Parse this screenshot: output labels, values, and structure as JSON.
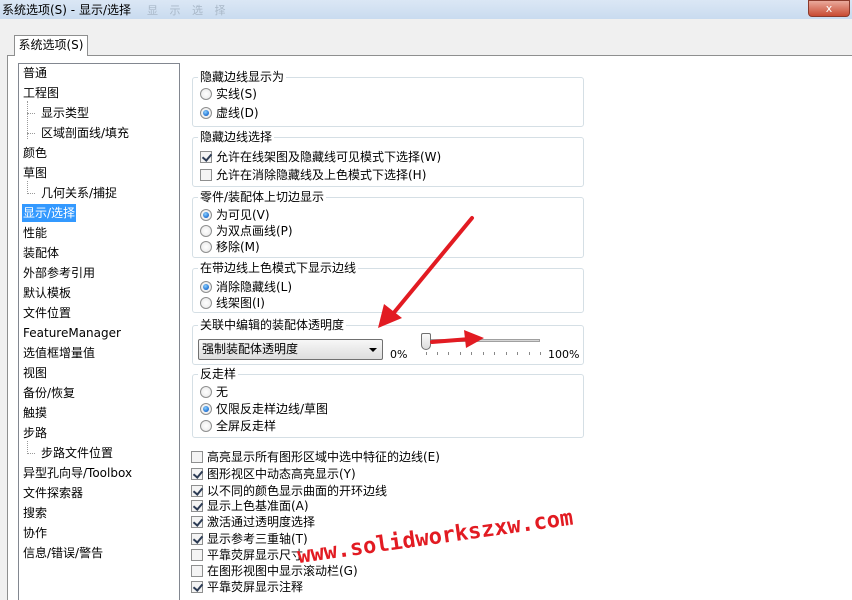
{
  "window": {
    "title": "系统选项(S) - 显示/选择",
    "faint_title": "显 示 选 择",
    "close_label": "x"
  },
  "tab": {
    "label": "系统选项(S)"
  },
  "tree": {
    "items": [
      "普通",
      "工程图",
      "显示类型",
      "区域剖面线/填充",
      "颜色",
      "草图",
      "几何关系/捕捉",
      "显示/选择",
      "性能",
      "装配体",
      "外部参考引用",
      "默认模板",
      "文件位置",
      "FeatureManager",
      "选值框增量值",
      "视图",
      "备份/恢复",
      "触摸",
      "步路",
      "步路文件位置",
      "异型孔向导/Toolbox",
      "文件探索器",
      "搜索",
      "协作",
      "信息/错误/警告"
    ]
  },
  "groups": {
    "hidden_edges_display": {
      "title": "隐藏边线显示为",
      "options": [
        {
          "label": "实线(S)",
          "selected": false
        },
        {
          "label": "虚线(D)",
          "selected": true
        }
      ]
    },
    "hidden_edges_select": {
      "title": "隐藏边线选择",
      "options": [
        {
          "label": "允许在线架图及隐藏线可见模式下选择(W)",
          "checked": true
        },
        {
          "label": "允许在消除隐藏线及上色模式下选择(H)",
          "checked": false
        }
      ]
    },
    "tangent_edges": {
      "title": "零件/装配体上切边显示",
      "options": [
        {
          "label": "为可见(V)",
          "selected": true
        },
        {
          "label": "为双点画线(P)",
          "selected": false
        },
        {
          "label": "移除(M)",
          "selected": false
        }
      ]
    },
    "shaded_edges": {
      "title": "在带边线上色模式下显示边线",
      "options": [
        {
          "label": "消除隐藏线(L)",
          "selected": true
        },
        {
          "label": "线架图(I)",
          "selected": false
        }
      ]
    },
    "transparency": {
      "title": "关联中编辑的装配体透明度",
      "dropdown_value": "强制装配体透明度",
      "min_label": "0%",
      "max_label": "100%",
      "slider_value": 0
    },
    "antialias": {
      "title": "反走样",
      "options": [
        {
          "label": "无",
          "selected": false
        },
        {
          "label": "仅限反走样边线/草图",
          "selected": true
        },
        {
          "label": "全屏反走样",
          "selected": false
        }
      ]
    }
  },
  "checkboxes": [
    {
      "label": "高亮显示所有图形区域中选中特征的边线(E)",
      "checked": false
    },
    {
      "label": "图形视区中动态高亮显示(Y)",
      "checked": true
    },
    {
      "label": "以不同的颜色显示曲面的开环边线",
      "checked": true
    },
    {
      "label": "显示上色基准面(A)",
      "checked": true
    },
    {
      "label": "激活通过透明度选择",
      "checked": true
    },
    {
      "label": "显示参考三重轴(T)",
      "checked": true
    },
    {
      "label": "平靠荧屏显示尺寸",
      "checked": false
    },
    {
      "label": "在图形视图中显示滚动栏(G)",
      "checked": false
    },
    {
      "label": "平靠荧屏显示注释",
      "checked": true
    }
  ],
  "watermark": {
    "text": "www.solidworkszxw.com"
  },
  "colors": {
    "selection": "#3399ff",
    "annotation": "#e21b22"
  }
}
